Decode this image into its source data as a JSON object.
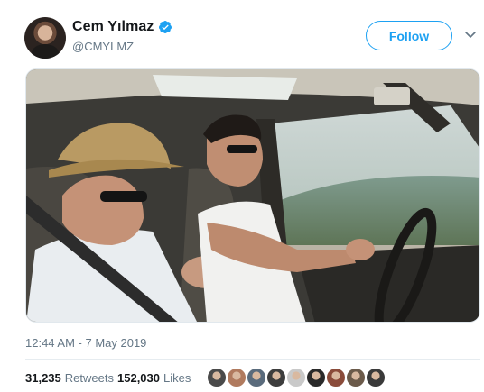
{
  "tweet": {
    "author": {
      "display_name": "Cem Yılmaz",
      "handle": "@CMYLMZ",
      "verified": true
    },
    "follow_label": "Follow",
    "timestamp": "12:44 AM - 7 May 2019",
    "stats": {
      "retweets_count": "31,235",
      "retweets_label": "Retweets",
      "likes_count": "152,030",
      "likes_label": "Likes"
    },
    "liker_avatars": [
      "#4a4a4a",
      "#b07a5e",
      "#5a6b7c",
      "#3d3d3d",
      "#c9c9c9",
      "#2a2a2a",
      "#8a4b3a",
      "#6b5a4a",
      "#3a3a3a"
    ]
  },
  "colors": {
    "accent": "#1da1f2",
    "secondary_text": "#657786"
  },
  "icons": [
    "verified-badge-icon",
    "chevron-down-icon"
  ]
}
